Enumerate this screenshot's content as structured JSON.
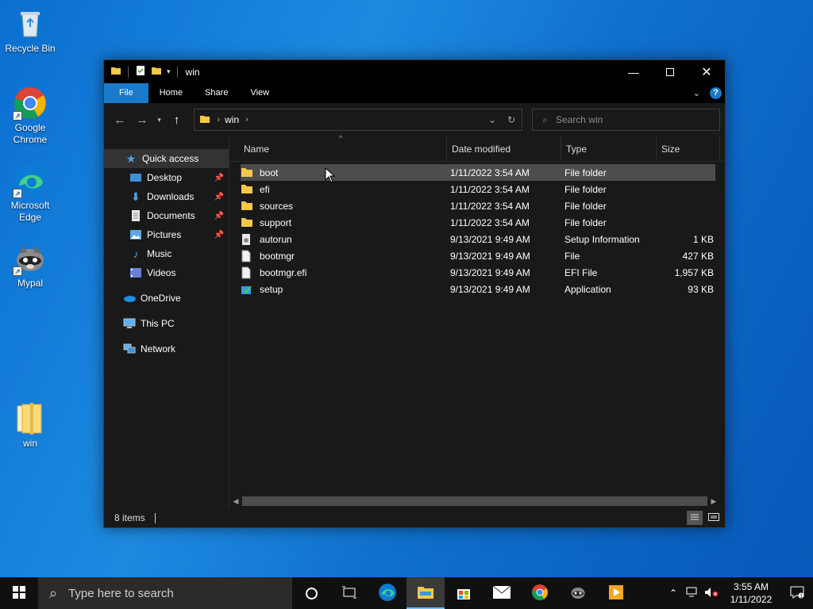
{
  "desktop": {
    "icons": [
      {
        "label": "Recycle Bin",
        "icon": "recycle-bin-icon"
      },
      {
        "label": "Google Chrome",
        "icon": "chrome-icon"
      },
      {
        "label": "Microsoft Edge",
        "icon": "edge-icon"
      },
      {
        "label": "Mypal",
        "icon": "mypal-icon"
      },
      {
        "label": "win",
        "icon": "folder-icon"
      }
    ]
  },
  "window": {
    "title": "win",
    "ribbon_tabs": [
      "File",
      "Home",
      "Share",
      "View"
    ],
    "help": "?",
    "address": {
      "crumb": "win"
    },
    "search_placeholder": "Search win",
    "nav_pane": {
      "quick_access": "Quick access",
      "items": [
        "Desktop",
        "Downloads",
        "Documents",
        "Pictures",
        "Music",
        "Videos"
      ],
      "onedrive": "OneDrive",
      "this_pc": "This PC",
      "network": "Network"
    },
    "columns": {
      "name": "Name",
      "date": "Date modified",
      "type": "Type",
      "size": "Size"
    },
    "files": [
      {
        "name": "boot",
        "date": "1/11/2022 3:54 AM",
        "type": "File folder",
        "size": "",
        "icon": "folder-icon"
      },
      {
        "name": "efi",
        "date": "1/11/2022 3:54 AM",
        "type": "File folder",
        "size": "",
        "icon": "folder-icon"
      },
      {
        "name": "sources",
        "date": "1/11/2022 3:54 AM",
        "type": "File folder",
        "size": "",
        "icon": "folder-icon"
      },
      {
        "name": "support",
        "date": "1/11/2022 3:54 AM",
        "type": "File folder",
        "size": "",
        "icon": "folder-icon"
      },
      {
        "name": "autorun",
        "date": "9/13/2021 9:49 AM",
        "type": "Setup Information",
        "size": "1 KB",
        "icon": "setup-info-icon"
      },
      {
        "name": "bootmgr",
        "date": "9/13/2021 9:49 AM",
        "type": "File",
        "size": "427 KB",
        "icon": "file-icon"
      },
      {
        "name": "bootmgr.efi",
        "date": "9/13/2021 9:49 AM",
        "type": "EFI File",
        "size": "1,957 KB",
        "icon": "file-icon"
      },
      {
        "name": "setup",
        "date": "9/13/2021 9:49 AM",
        "type": "Application",
        "size": "93 KB",
        "icon": "setup-app-icon"
      }
    ],
    "status": "8 items"
  },
  "taskbar": {
    "search_placeholder": "Type here to search",
    "time": "3:55 AM",
    "date": "1/11/2022"
  },
  "colors": {
    "accent": "#1979ca",
    "folder": "#f4c74a",
    "desktop": "#0f6fcc"
  }
}
